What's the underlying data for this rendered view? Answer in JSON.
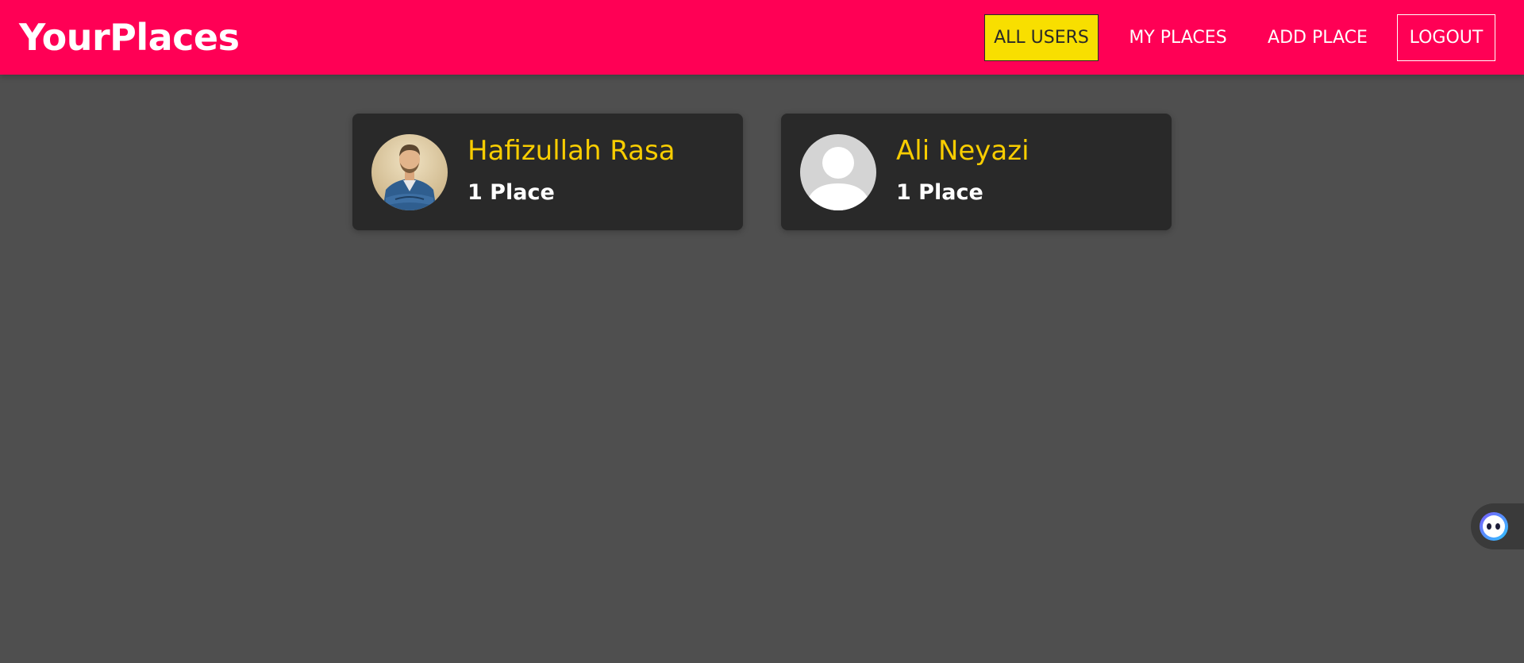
{
  "header": {
    "logo": "YourPlaces",
    "nav": [
      {
        "label": "ALL USERS",
        "active": true
      },
      {
        "label": "MY PLACES"
      },
      {
        "label": "ADD PLACE"
      },
      {
        "label": "LOGOUT"
      }
    ]
  },
  "users": [
    {
      "name": "Hafizullah Rasa",
      "places": "1 Place",
      "avatar": "photo"
    },
    {
      "name": "Ali Neyazi",
      "places": "1 Place",
      "avatar": "default-person-icon"
    }
  ],
  "colors": {
    "header_bg": "#ff0055",
    "page_bg": "#4f4f4f",
    "card_bg": "#292929",
    "accent_yellow": "#f8df00",
    "name_color": "#f8cd00"
  },
  "widget": {
    "icon": "assistant-face-icon"
  }
}
